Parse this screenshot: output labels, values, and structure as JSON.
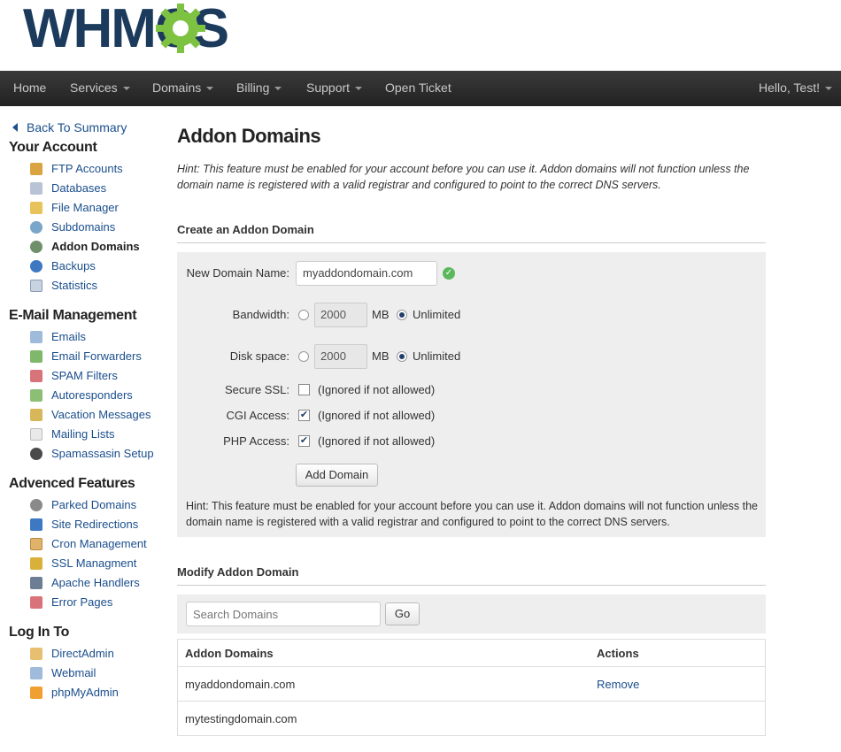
{
  "brand": {
    "logo_text": "WHMCS"
  },
  "nav": {
    "items": [
      {
        "label": "Home"
      },
      {
        "label": "Services"
      },
      {
        "label": "Domains"
      },
      {
        "label": "Billing"
      },
      {
        "label": "Support"
      },
      {
        "label": "Open Ticket"
      }
    ],
    "user": "Hello, Test!"
  },
  "sidebar": {
    "back": "Back To Summary",
    "sections": [
      {
        "title": "Your Account",
        "items": [
          "FTP Accounts",
          "Databases",
          "File Manager",
          "Subdomains",
          "Addon Domains",
          "Backups",
          "Statistics"
        ]
      },
      {
        "title": "E-Mail Management",
        "items": [
          "Emails",
          "Email Forwarders",
          "SPAM Filters",
          "Autoresponders",
          "Vacation Messages",
          "Mailing Lists",
          "Spamassasin Setup"
        ]
      },
      {
        "title": "Advenced Features",
        "items": [
          "Parked Domains",
          "Site Redirections",
          "Cron Management",
          "SSL Managment",
          "Apache Handlers",
          "Error Pages"
        ]
      },
      {
        "title": "Log In To",
        "items": [
          "DirectAdmin",
          "Webmail",
          "phpMyAdmin"
        ]
      }
    ]
  },
  "main": {
    "title": "Addon Domains",
    "hint": "Hint: This feature must be enabled for your account before you can use it. Addon domains will not function unless the domain name is registered with a valid registrar and configured to point to the correct DNS servers.",
    "create": {
      "heading": "Create an Addon Domain",
      "domain_label": "New Domain Name:",
      "domain_value": "myaddondomain.com",
      "bandwidth_label": "Bandwidth:",
      "bandwidth_value": "2000",
      "disk_label": "Disk space:",
      "disk_value": "2000",
      "unit": "MB",
      "unlimited": "Unlimited",
      "ssl_label": "Secure SSL:",
      "cgi_label": "CGI Access:",
      "php_label": "PHP Access:",
      "ignored": "(Ignored if not allowed)",
      "add_button": "Add Domain",
      "hint": "Hint: This feature must be enabled for your account before you can use it. Addon domains will not function unless the domain name is registered with a valid registrar and configured to point to the correct DNS servers."
    },
    "modify": {
      "heading": "Modify Addon Domain",
      "search_placeholder": "Search Domains",
      "go_button": "Go",
      "col_domains": "Addon Domains",
      "col_actions": "Actions",
      "rows": [
        {
          "domain": "myaddondomain.com",
          "action": "Remove"
        },
        {
          "domain": "mytestingdomain.com",
          "action": ""
        }
      ]
    }
  },
  "colors": {
    "navbar": "#2b2b2b",
    "link": "#1a4e8c",
    "logo": "#1b3a5c",
    "logo_gear": "#7ec242"
  }
}
